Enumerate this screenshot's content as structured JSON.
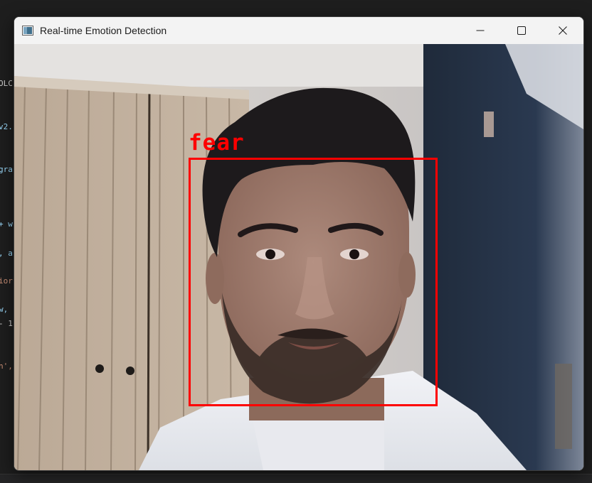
{
  "window": {
    "title": "Real-time Emotion Detection",
    "icon": "app-window-icon"
  },
  "titlebar_buttons": {
    "minimize": "minimize-icon",
    "maximize": "maximize-icon",
    "close": "close-icon"
  },
  "detection": {
    "label": "fear",
    "color": "#ff0000"
  },
  "background_editor": {
    "fragments": [
      "OLC",
      "v2.",
      "gra",
      "+ w",
      ", a",
      "ior",
      "w,",
      "- 1",
      "n',"
    ]
  }
}
